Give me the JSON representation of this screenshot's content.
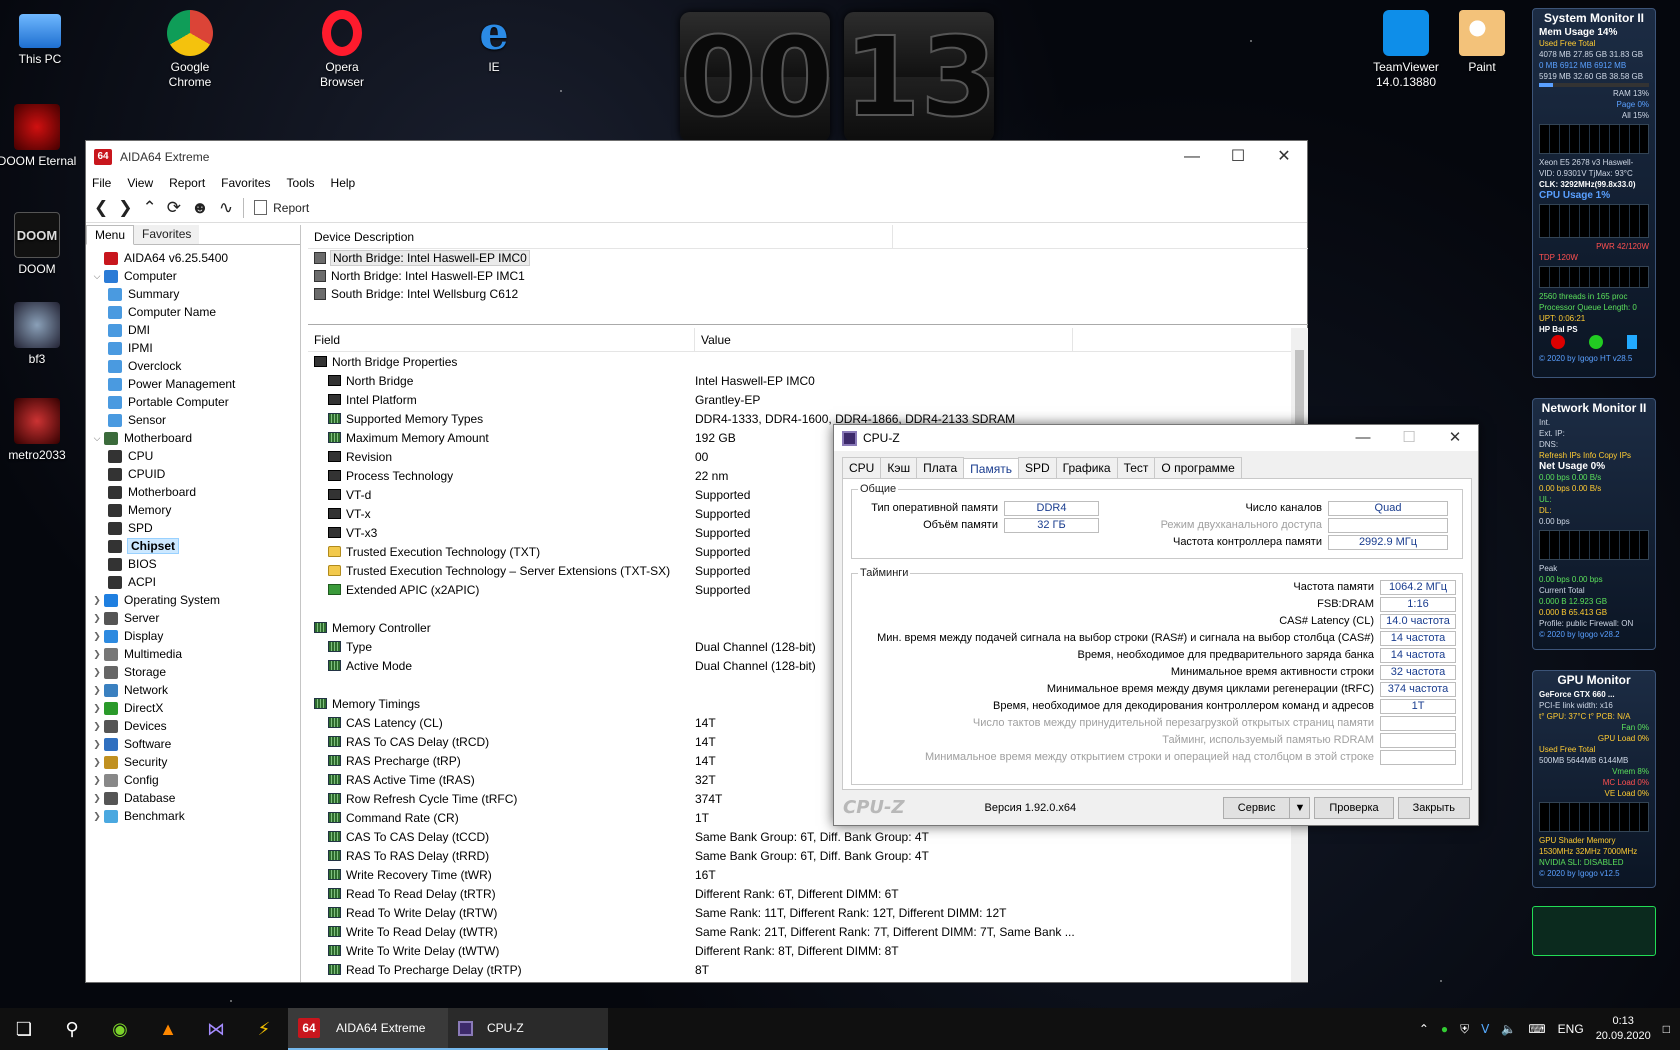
{
  "desktop": {
    "icons": [
      {
        "label": "This PC"
      },
      {
        "label": "DOOM Eternal"
      },
      {
        "label": "DOOM"
      },
      {
        "label": "bf3"
      },
      {
        "label": "metro2033"
      },
      {
        "label": "Google Chrome"
      },
      {
        "label": "Opera Browser"
      },
      {
        "label": "IE"
      },
      {
        "label": "TeamViewer 14.0.13880"
      },
      {
        "label": "Paint"
      }
    ],
    "clock": {
      "hours": "00",
      "minutes": "13"
    }
  },
  "aida": {
    "title": "AIDA64 Extreme",
    "logo": "64",
    "menu": [
      "File",
      "View",
      "Report",
      "Favorites",
      "Tools",
      "Help"
    ],
    "toolbar_report": "Report",
    "pane_tabs": {
      "menu": "Menu",
      "favorites": "Favorites"
    },
    "tree": {
      "root": "AIDA64 v6.25.5400",
      "computer": "Computer",
      "computer_children": [
        "Summary",
        "Computer Name",
        "DMI",
        "IPMI",
        "Overclock",
        "Power Management",
        "Portable Computer",
        "Sensor"
      ],
      "motherboard": "Motherboard",
      "motherboard_children": [
        "CPU",
        "CPUID",
        "Motherboard",
        "Memory",
        "SPD",
        "Chipset",
        "BIOS",
        "ACPI"
      ],
      "others": [
        "Operating System",
        "Server",
        "Display",
        "Multimedia",
        "Storage",
        "Network",
        "DirectX",
        "Devices",
        "Software",
        "Security",
        "Config",
        "Database",
        "Benchmark"
      ]
    },
    "device_header": "Device Description",
    "devices": [
      "North Bridge: Intel Haswell-EP IMC0",
      "North Bridge: Intel Haswell-EP IMC1",
      "South Bridge: Intel Wellsburg C612"
    ],
    "field_header": "Field",
    "value_header": "Value",
    "rows": [
      {
        "f": "North Bridge Properties",
        "v": "",
        "t": "group",
        "i": "chip"
      },
      {
        "f": "North Bridge",
        "v": "Intel Haswell-EP IMC0",
        "t": "item",
        "i": "chip"
      },
      {
        "f": "Intel Platform",
        "v": "Grantley-EP",
        "t": "item",
        "i": "chip"
      },
      {
        "f": "Supported Memory Types",
        "v": "DDR4-1333, DDR4-1600, DDR4-1866, DDR4-2133 SDRAM",
        "t": "item",
        "i": "mem"
      },
      {
        "f": "Maximum Memory Amount",
        "v": "192 GB",
        "t": "item",
        "i": "mem"
      },
      {
        "f": "Revision",
        "v": "00",
        "t": "item",
        "i": "chip"
      },
      {
        "f": "Process Technology",
        "v": "22 nm",
        "t": "item",
        "i": "chip"
      },
      {
        "f": "VT-d",
        "v": "Supported",
        "t": "item",
        "i": "chip"
      },
      {
        "f": "VT-x",
        "v": "Supported",
        "t": "item",
        "i": "chip"
      },
      {
        "f": "VT-x3",
        "v": "Supported",
        "t": "item",
        "i": "chip"
      },
      {
        "f": "Trusted Execution Technology (TXT)",
        "v": "Supported",
        "t": "item",
        "i": "lock"
      },
      {
        "f": "Trusted Execution Technology – Server Extensions (TXT-SX)",
        "v": "Supported",
        "t": "item",
        "i": "lock"
      },
      {
        "f": "Extended APIC (x2APIC)",
        "v": "Supported",
        "t": "item",
        "i": "green"
      },
      {
        "f": "",
        "v": "",
        "t": "blank",
        "i": ""
      },
      {
        "f": "Memory Controller",
        "v": "",
        "t": "group",
        "i": "mem"
      },
      {
        "f": "Type",
        "v": "Dual Channel  (128-bit)",
        "t": "item",
        "i": "mem"
      },
      {
        "f": "Active Mode",
        "v": "Dual Channel  (128-bit)",
        "t": "item",
        "i": "mem"
      },
      {
        "f": "",
        "v": "",
        "t": "blank",
        "i": ""
      },
      {
        "f": "Memory Timings",
        "v": "",
        "t": "group",
        "i": "mem"
      },
      {
        "f": "CAS Latency (CL)",
        "v": "14T",
        "t": "item",
        "i": "mem"
      },
      {
        "f": "RAS To CAS Delay (tRCD)",
        "v": "14T",
        "t": "item",
        "i": "mem"
      },
      {
        "f": "RAS Precharge (tRP)",
        "v": "14T",
        "t": "item",
        "i": "mem"
      },
      {
        "f": "RAS Active Time (tRAS)",
        "v": "32T",
        "t": "item",
        "i": "mem"
      },
      {
        "f": "Row Refresh Cycle Time (tRFC)",
        "v": "374T",
        "t": "item",
        "i": "mem"
      },
      {
        "f": "Command Rate (CR)",
        "v": "1T",
        "t": "item",
        "i": "mem"
      },
      {
        "f": "CAS To CAS Delay (tCCD)",
        "v": "Same Bank Group: 6T, Diff. Bank Group: 4T",
        "t": "item",
        "i": "mem"
      },
      {
        "f": "RAS To RAS Delay (tRRD)",
        "v": "Same Bank Group: 6T, Diff. Bank Group: 4T",
        "t": "item",
        "i": "mem"
      },
      {
        "f": "Write Recovery Time (tWR)",
        "v": "16T",
        "t": "item",
        "i": "mem"
      },
      {
        "f": "Read To Read Delay (tRTR)",
        "v": "Different Rank: 6T, Different DIMM: 6T",
        "t": "item",
        "i": "mem"
      },
      {
        "f": "Read To Write Delay (tRTW)",
        "v": "Same Rank: 11T, Different Rank: 12T, Different DIMM: 12T",
        "t": "item",
        "i": "mem"
      },
      {
        "f": "Write To Read Delay (tWTR)",
        "v": "Same Rank: 21T, Different Rank: 7T, Different DIMM: 7T, Same Bank ...",
        "t": "item",
        "i": "mem"
      },
      {
        "f": "Write To Write Delay (tWTW)",
        "v": "Different Rank: 8T, Different DIMM: 8T",
        "t": "item",
        "i": "mem"
      },
      {
        "f": "Read To Precharge Delay (tRTP)",
        "v": "8T",
        "t": "item",
        "i": "mem"
      }
    ]
  },
  "cpuz": {
    "title": "CPU-Z",
    "tabs": [
      "CPU",
      "Кэш",
      "Плата",
      "Память",
      "SPD",
      "Графика",
      "Тест",
      "О программе"
    ],
    "active_tab": "Память",
    "general_legend": "Общие",
    "mem_type_label": "Тип оперативной памяти",
    "mem_type": "DDR4",
    "mem_size_label": "Объём памяти",
    "mem_size": "32 ГБ",
    "channels_label": "Число каналов",
    "channels": "Quad",
    "dc_mode_label": "Режим двухканального доступа",
    "uncore_label": "Частота контроллера памяти",
    "uncore": "2992.9 МГц",
    "timings_legend": "Тайминги",
    "timings": [
      {
        "label": "Частота памяти",
        "value": "1064.2 МГц",
        "grey": false
      },
      {
        "label": "FSB:DRAM",
        "value": "1:16",
        "grey": false
      },
      {
        "label": "CAS# Latency (CL)",
        "value": "14.0 частота",
        "grey": false
      },
      {
        "label": "Мин. время между подачей сигнала на выбор строки (RAS#) и сигнала на выбор столбца (CAS#)",
        "value": "14 частота",
        "grey": false
      },
      {
        "label": "Время, необходимое для предварительного заряда банка",
        "value": "14 частота",
        "grey": false
      },
      {
        "label": "Минимальное время активности строки",
        "value": "32 частота",
        "grey": false
      },
      {
        "label": "Минимальное время между двумя циклами регенерации (tRFC)",
        "value": "374 частота",
        "grey": false
      },
      {
        "label": "Время, необходимое для декодирования контроллером команд и адресов",
        "value": "1T",
        "grey": false
      },
      {
        "label": "Число тактов между принудительной перезагрузкой открытых страниц памяти",
        "value": "",
        "grey": true
      },
      {
        "label": "Тайминг, используемый памятью RDRAM",
        "value": "",
        "grey": true
      },
      {
        "label": "Минимальное время между открытием строки и операцией над столбцом в этой строке",
        "value": "",
        "grey": true
      }
    ],
    "brand": "CPU-Z",
    "version": "Версия 1.92.0.x64",
    "btn_service": "Сервис",
    "btn_validate": "Проверка",
    "btn_close": "Закрыть"
  },
  "gadgets": {
    "sysmon": {
      "title": "System Monitor II",
      "lines": [
        "Mem Usage   14%",
        "Used  Free  Total",
        "4078 MB 27.85 GB 31.83 GB",
        "0 MB 6912 MB 6912 MB",
        "5919 MB 32.60 GB 38.58 GB",
        "RAM 13%",
        "Page 0%",
        "All 15%",
        "Xeon E5 2678 v3 Haswell-",
        "VID: 0.9301V TjMax: 93°C",
        "CLK: 3292MHz(99.8x33.0)",
        "CPU Usage   1%",
        "PWR 42/120W",
        "TDP 120W",
        "2560 threads in 165 proc",
        "Processor Queue Length: 0",
        "UPT: 0:06:21",
        "HP  Bal  PS",
        "© 2020 by Igogo  HT v28.5"
      ]
    },
    "netmon": {
      "title": "Network Monitor II",
      "lines": [
        "Int.",
        "Ext. IP:",
        "DNS:",
        "Refresh IPs  Info  Copy IPs",
        "Net Usage   0%",
        "0.00 bps   0.00 B/s",
        "0.00 bps   0.00 B/s",
        "UL:",
        "DL:",
        "0.00 bps",
        "Peak",
        "0.00 bps   0.00 bps",
        "Current   Total",
        "0.000 B   12.923 GB",
        "0.000 B   65.413 GB",
        "Profile: public  Firewall: ON",
        "© 2020 by Igogo  v28.2"
      ]
    },
    "gpumon": {
      "title": "GPU Monitor",
      "lines": [
        "GeForce GTX 660 ...",
        "PCI-E link width: x16",
        "t° GPU: 37°C   t° PCB: N/A",
        "Fan 0%",
        "GPU Load 0%",
        "Used  Free  Total",
        "500MB 5644MB 6144MB",
        "Vmem 8%",
        "MC Load 0%",
        "VE Load 0%",
        "GPU  Shader  Memory",
        "1530MHz 32MHz 7000MHz",
        "NVIDIA SLI: DISABLED",
        "© 2020 by Igogo  v12.5"
      ]
    }
  },
  "taskbar": {
    "tasks": [
      {
        "label": "AIDA64 Extreme"
      },
      {
        "label": "CPU-Z"
      }
    ],
    "lang": "ENG",
    "time": "0:13",
    "date": "20.09.2020"
  }
}
